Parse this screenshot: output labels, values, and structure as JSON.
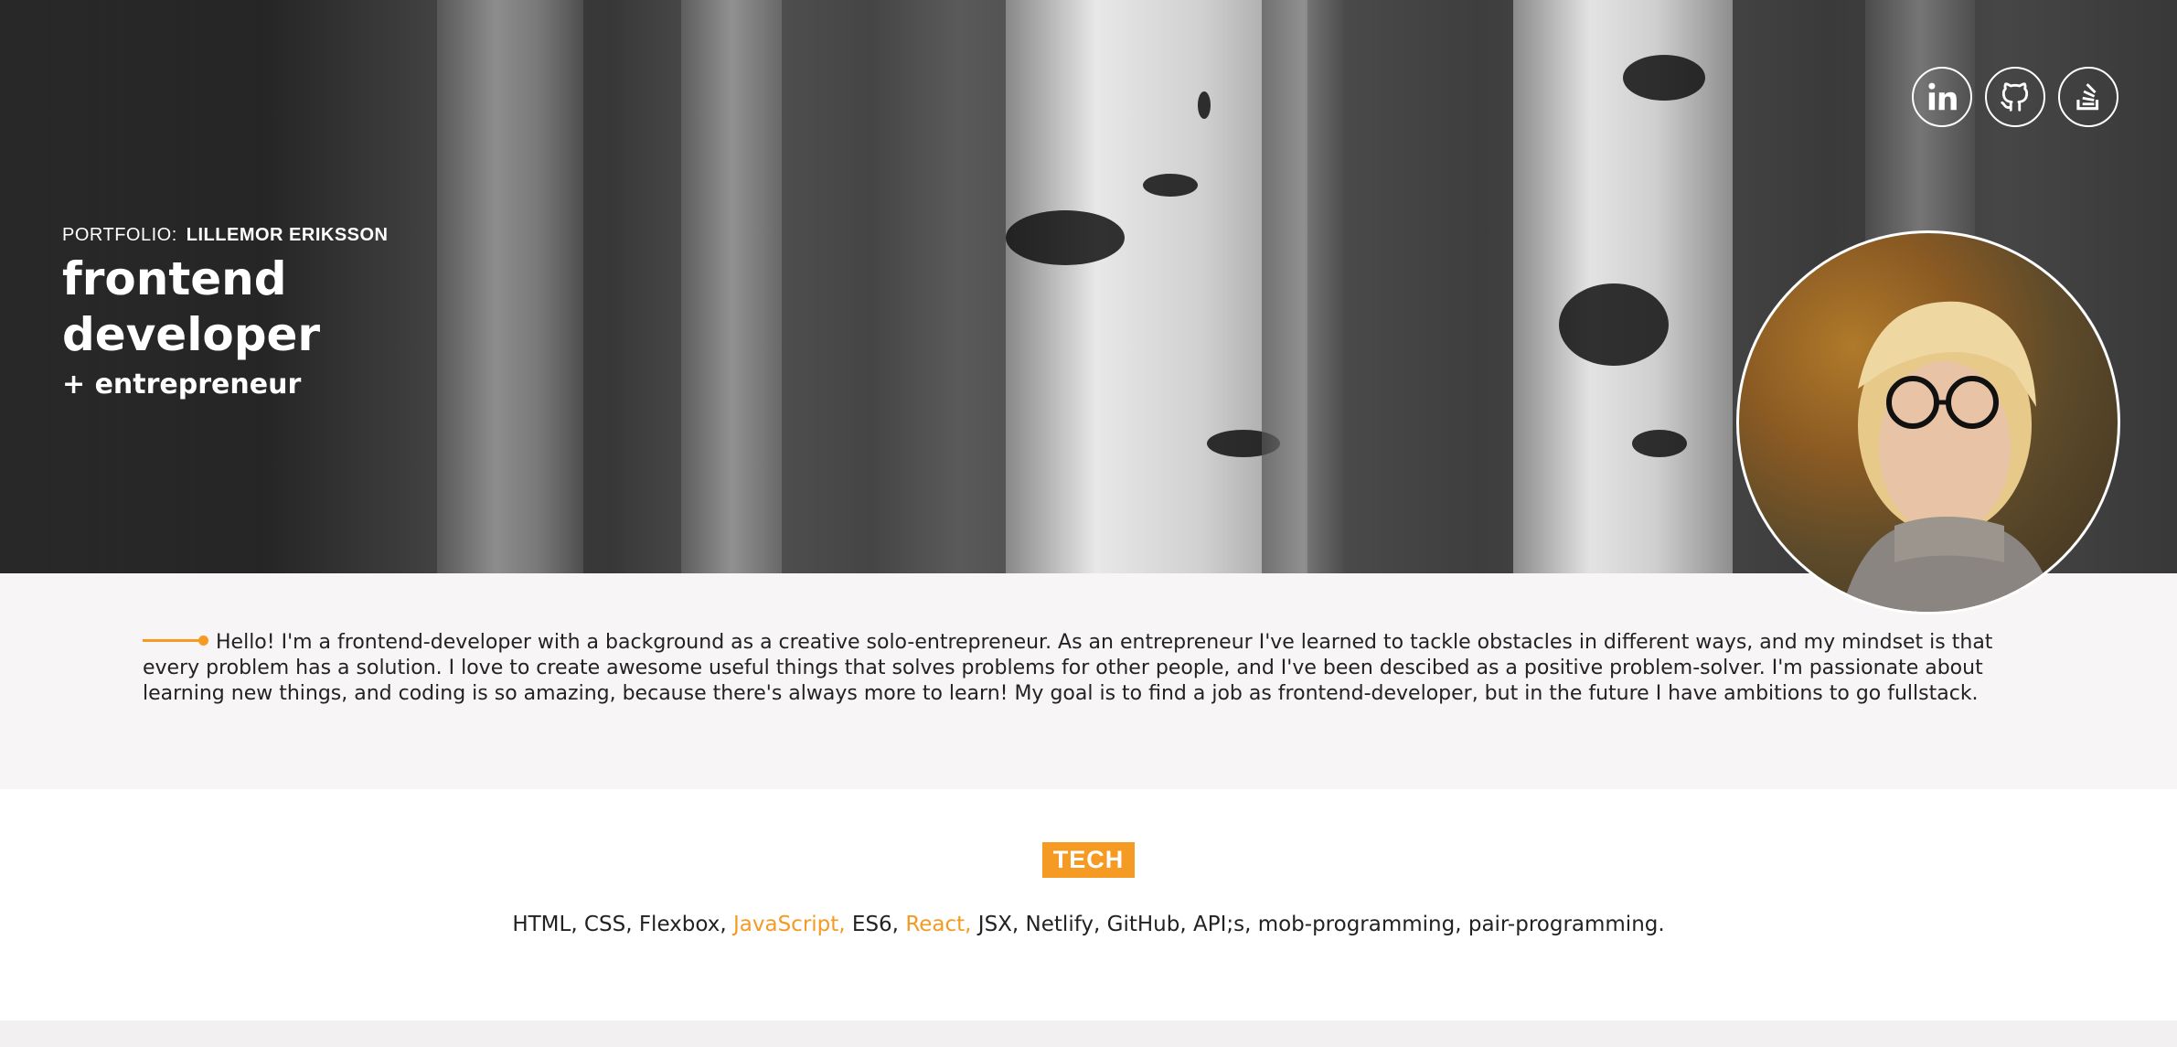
{
  "hero": {
    "portfolio_label": "PORTFOLIO:",
    "name": "LILLEMOR ERIKSSON",
    "role": "frontend developer",
    "subrole": "+ entrepreneur"
  },
  "socials": [
    {
      "icon": "linkedin-icon",
      "label": "in"
    },
    {
      "icon": "github-icon"
    },
    {
      "icon": "stackoverflow-icon"
    }
  ],
  "about": {
    "text": "Hello! I'm a frontend-developer with a background as a creative solo-entrepreneur. As an entrepreneur I've learned to tackle obstacles in different ways, and my mindset is that every problem has a solution. I love to create awesome useful things that solves problems for other people, and I've been descibed as a positive problem-solver. I'm passionate about learning new things, and coding is so amazing, because there's always more to learn! My goal is to find a job as frontend-developer, but in the future I have ambitions to go fullstack."
  },
  "tech": {
    "title": "TECH",
    "items": [
      {
        "text": "HTML, CSS, Flexbox, ",
        "highlight": false
      },
      {
        "text": "JavaScript, ",
        "highlight": true
      },
      {
        "text": "ES6, ",
        "highlight": false
      },
      {
        "text": "React, ",
        "highlight": true
      },
      {
        "text": "JSX, Netlify, GitHub, API;s, mob-programming, pair-programming.",
        "highlight": false
      }
    ]
  },
  "colors": {
    "accent": "#f59a22",
    "about_bg": "#f7f5f5"
  }
}
